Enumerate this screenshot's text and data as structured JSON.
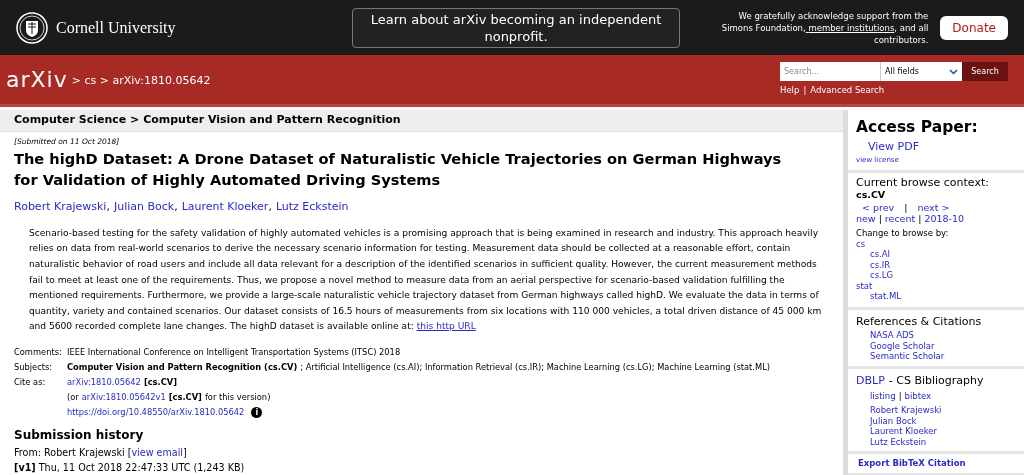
{
  "top_bar": {
    "brand": "Cornell University",
    "banner": "Learn about arXiv becoming an independent nonprofit.",
    "support": [
      {
        "kind": "plain",
        "text": "We gratefully acknowledge support from the Simons Foundation,"
      },
      {
        "kind": "link",
        "text": "member institutions"
      },
      {
        "kind": "plain",
        "text": ", and all contributors."
      }
    ],
    "donate": "Donate"
  },
  "header": {
    "logo": "arXiv",
    "breadcrumb": "> cs > arXiv:1810.05642",
    "search": {
      "placeholder": "Search...",
      "field": "All fields",
      "button": "Search"
    },
    "links": [
      "Help",
      "Advanced Search"
    ],
    "separator": "|"
  },
  "paper": {
    "category_path": "Computer Science > Computer Vision and Pattern Recognition",
    "submitted": "[Submitted on 11 Oct 2018]",
    "title": "The highD Dataset: A Drone Dataset of Naturalistic Vehicle Trajectories on German Highways for Validation of Highly Automated Driving Systems",
    "authors": [
      "Robert Krajewski",
      "Julian Bock",
      "Laurent Kloeker",
      "Lutz Eckstein"
    ],
    "author_separator": ",",
    "abstract": {
      "text": "Scenario-based testing for the safety validation of highly automated vehicles is a promising approach that is being examined in research and industry. This approach heavily relies on data from real-world scenarios to derive the necessary scenario information for testing. Measurement data should be collected at a reasonable effort, contain naturalistic behavior of road users and include all data relevant for a description of the identified scenarios in sufficient quality. However, the current measurement methods fail to meet at least one of the requirements. Thus, we propose a novel method to measure data from an aerial perspective for scenario-based validation fulfilling the mentioned requirements. Furthermore, we provide a large-scale naturalistic vehicle trajectory dataset from German highways called highD. We evaluate the data in terms of quantity, variety and contained scenarios. Our dataset consists of 16.5 hours of measurements from six locations with 110 000 vehicles, a total driven distance of 45 000 km and 5600 recorded complete lane changes. The highD dataset is available online at:",
      "link": "this http URL"
    },
    "metadata": [
      {
        "label": "Comments:",
        "lines": [
          [
            {
              "kind": "plain",
              "text": "IEEE International Conference on Intelligent Transportation Systems (ITSC) 2018"
            }
          ]
        ]
      },
      {
        "label": "Subjects:",
        "lines": [
          [
            {
              "kind": "bold",
              "text": "Computer Vision and Pattern Recognition (cs.CV)"
            },
            {
              "kind": "plain",
              "text": "; Artificial Intelligence (cs.AI); Information Retrieval (cs.IR); Machine Learning (cs.LG); Machine Learning (stat.ML)"
            }
          ]
        ]
      },
      {
        "label": "Cite as:",
        "lines": [
          [
            {
              "kind": "link",
              "text": "arXiv:1810.05642"
            },
            {
              "kind": "bold",
              "text": "[cs.CV]"
            }
          ],
          [
            {
              "kind": "plain",
              "text": "(or"
            },
            {
              "kind": "link",
              "text": "arXiv:1810.05642v1"
            },
            {
              "kind": "bold",
              "text": "[cs.CV]"
            },
            {
              "kind": "plain",
              "text": "for this version)"
            }
          ],
          [
            {
              "kind": "link",
              "text": "https://doi.org/10.48550/arXiv.1810.05642"
            },
            {
              "kind": "info",
              "text": "i"
            }
          ]
        ]
      }
    ],
    "history": {
      "title": "Submission history",
      "from": "From: Robert Krajewski",
      "email_link": "view email",
      "open": "[",
      "close": "]",
      "versions": [
        "**[v1]** Thu, 11 Oct 2018 22:47:33 UTC (1,243 KB)"
      ]
    }
  },
  "sidebar": {
    "access": {
      "title": "Access Paper:",
      "links": [
        "View PDF"
      ],
      "license": "view license"
    },
    "browse": {
      "title": "Current browse context:",
      "context": "cs.CV",
      "prev": "< prev",
      "separator": "|",
      "next": "next >",
      "nav": [
        "new",
        "recent",
        "2018-10"
      ],
      "change_label": "Change to browse by:",
      "tree": [
        {
          "label": "cs",
          "children": [
            {
              "label": "cs.AI"
            },
            {
              "label": "cs.IR"
            },
            {
              "label": "cs.LG"
            }
          ]
        },
        {
          "label": "stat",
          "children": [
            {
              "label": "stat.ML"
            }
          ]
        }
      ]
    },
    "references": {
      "title": "References & Citations",
      "links": [
        "NASA ADS",
        "Google Scholar",
        "Semantic Scholar"
      ]
    },
    "dblp": {
      "link": "DBLP",
      "title": "- CS Bibliography",
      "tools": [
        "listing",
        "bibtex"
      ],
      "authors": [
        "Robert Krajewski",
        "Julian Bock",
        "Laurent Kloeker",
        "Lutz Eckstein"
      ]
    },
    "export": "Export BibTeX Citation"
  }
}
